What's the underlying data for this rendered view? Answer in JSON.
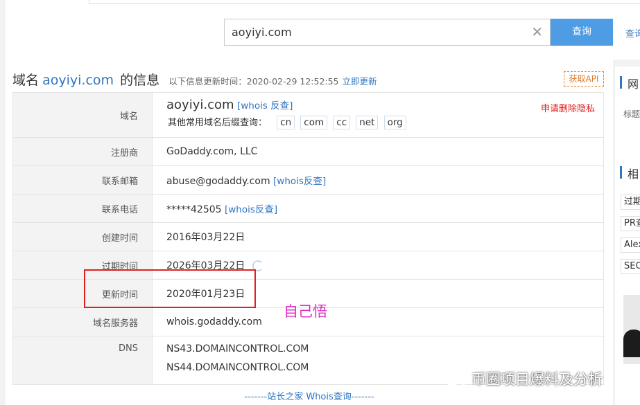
{
  "search": {
    "value": "aoyiyi.com",
    "button_label": "查询",
    "side_link": "查询"
  },
  "header": {
    "prefix": "域名",
    "domain": "aoyiyi.com",
    "suffix": "的信息",
    "update_text": "以下信息更新时间：2020-02-29 12:52:55",
    "update_link": "立即更新",
    "api_button": "获取API"
  },
  "rows": {
    "domain": {
      "label": "域名",
      "value": "aoyiyi.com",
      "whois_link": "[whois 反查]",
      "other_label": "其他常用域名后缀查询：",
      "suffixes": [
        "cn",
        "com",
        "cc",
        "net",
        "org"
      ],
      "privacy_link": "申请删除隐私"
    },
    "registrar": {
      "label": "注册商",
      "value": "GoDaddy.com, LLC"
    },
    "email": {
      "label": "联系邮箱",
      "value": "abuse@godaddy.com",
      "link": "[whois反查]"
    },
    "phone": {
      "label": "联系电话",
      "value": "*****42505",
      "link": "[whois反查]"
    },
    "created": {
      "label": "创建时间",
      "value": "2016年03月22日"
    },
    "expires": {
      "label": "过期时间",
      "value": "2026年03月22日"
    },
    "updated": {
      "label": "更新时间",
      "value": "2020年01月23日"
    },
    "nameserver": {
      "label": "域名服务器",
      "value": "whois.godaddy.com"
    },
    "dns": {
      "label": "DNS",
      "values": [
        "NS43.DOMAINCONTROL.COM",
        "NS44.DOMAINCONTROL.COM"
      ]
    }
  },
  "bottom_link": "-------站长之家 Whois查询-------",
  "annotation": "自己悟",
  "watermark": "币圈项目爆料及分析",
  "sidebar": {
    "heading1": "网",
    "small1": "标题",
    "heading2": "相",
    "chips": [
      "过期",
      "PR查",
      "Alex",
      "SEO"
    ]
  },
  "colors": {
    "accent": "#4e9ce3",
    "link": "#2e75c2",
    "highlight": "#e02020",
    "annotation": "#e02ec8"
  }
}
